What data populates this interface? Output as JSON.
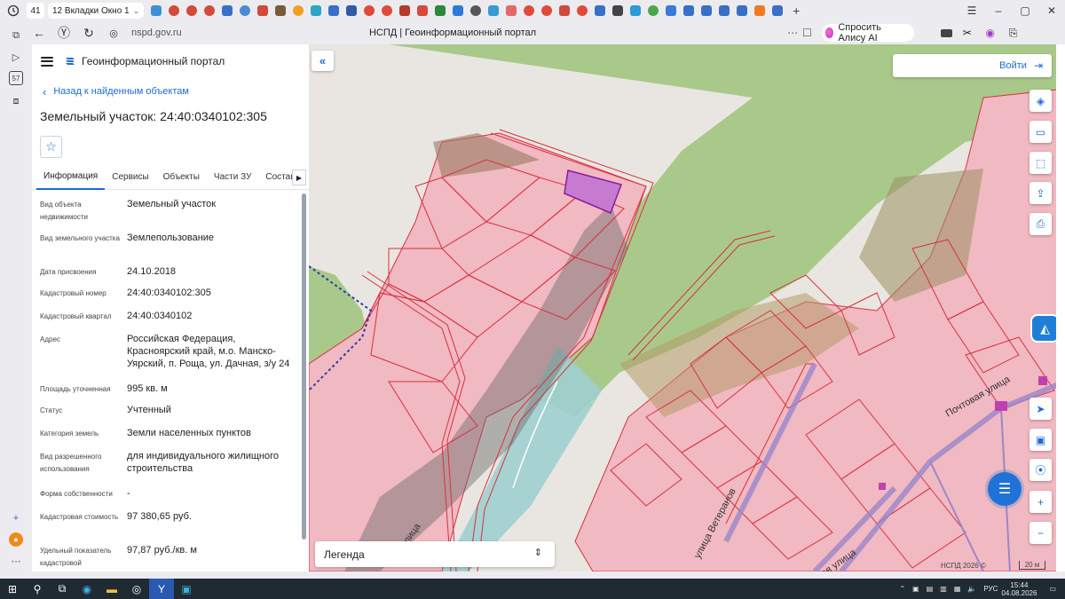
{
  "browser": {
    "tab_count": "41",
    "tab_group_label": "12  Вкладки Окно 1",
    "url": "nspd.gov.ru",
    "page_title": "НСПД | Геоинформационный портал",
    "alice_label": "Спросить Алису AI",
    "new_tab": "+",
    "left_badge": "57"
  },
  "sidebar": {
    "app_title": "Геоинформационный портал",
    "back_label": "Назад к найденным объектам",
    "object_title": "Земельный участок: 24:40:0340102:305",
    "tabs": [
      {
        "label": "Информация"
      },
      {
        "label": "Сервисы"
      },
      {
        "label": "Объекты"
      },
      {
        "label": "Части ЗУ"
      },
      {
        "label": "Состав"
      }
    ],
    "properties": [
      {
        "key": "Вид объекта недвижимости",
        "value": "Земельный участок"
      },
      {
        "key": "Вид земельного участка",
        "value": "Землепользование"
      },
      {
        "key": "Дата присвоения",
        "value": "24.10.2018"
      },
      {
        "key": "Кадастровый номер",
        "value": "24:40:0340102:305"
      },
      {
        "key": "Кадастровый квартал",
        "value": "24:40:0340102"
      },
      {
        "key": "Адрес",
        "value": "Российская Федерация, Красноярский край, м.о. Манско-Уярский, п. Роща, ул. Дачная, з/у 24"
      },
      {
        "key": "Площадь уточненная",
        "value": "995 кв. м"
      },
      {
        "key": "Статус",
        "value": "Учтенный"
      },
      {
        "key": "Категория земель",
        "value": "Земли населенных пунктов"
      },
      {
        "key": "Вид разрешенного использования",
        "value": "для индивидуального жилищного строительства"
      },
      {
        "key": "Форма собственности",
        "value": "-"
      },
      {
        "key": "Кадастровая стоимость",
        "value": "97 380,65 руб."
      },
      {
        "key": "Удельный показатель кадастровой",
        "value": "97,87 руб./кв. м"
      }
    ]
  },
  "map": {
    "login_label": "Войти",
    "legend_label": "Легенда",
    "copyright": "НСПД 2026 ©",
    "scale_label": "20 м",
    "streets": [
      "Почтовая улица",
      "улица Ветеранов",
      "ая улица",
      "ая улица"
    ],
    "colors": {
      "forest": "#a9c98a",
      "parcel": "#f1b9c1",
      "parcel_border": "#d9303f",
      "selected": "#c77bd0",
      "water": "#9fcfcf",
      "shadow": "#6b6b6b",
      "accent": "#1e6ad6"
    }
  },
  "taskbar": {
    "lang": "РУС",
    "time": "15:44",
    "date": "04.08.2026"
  }
}
